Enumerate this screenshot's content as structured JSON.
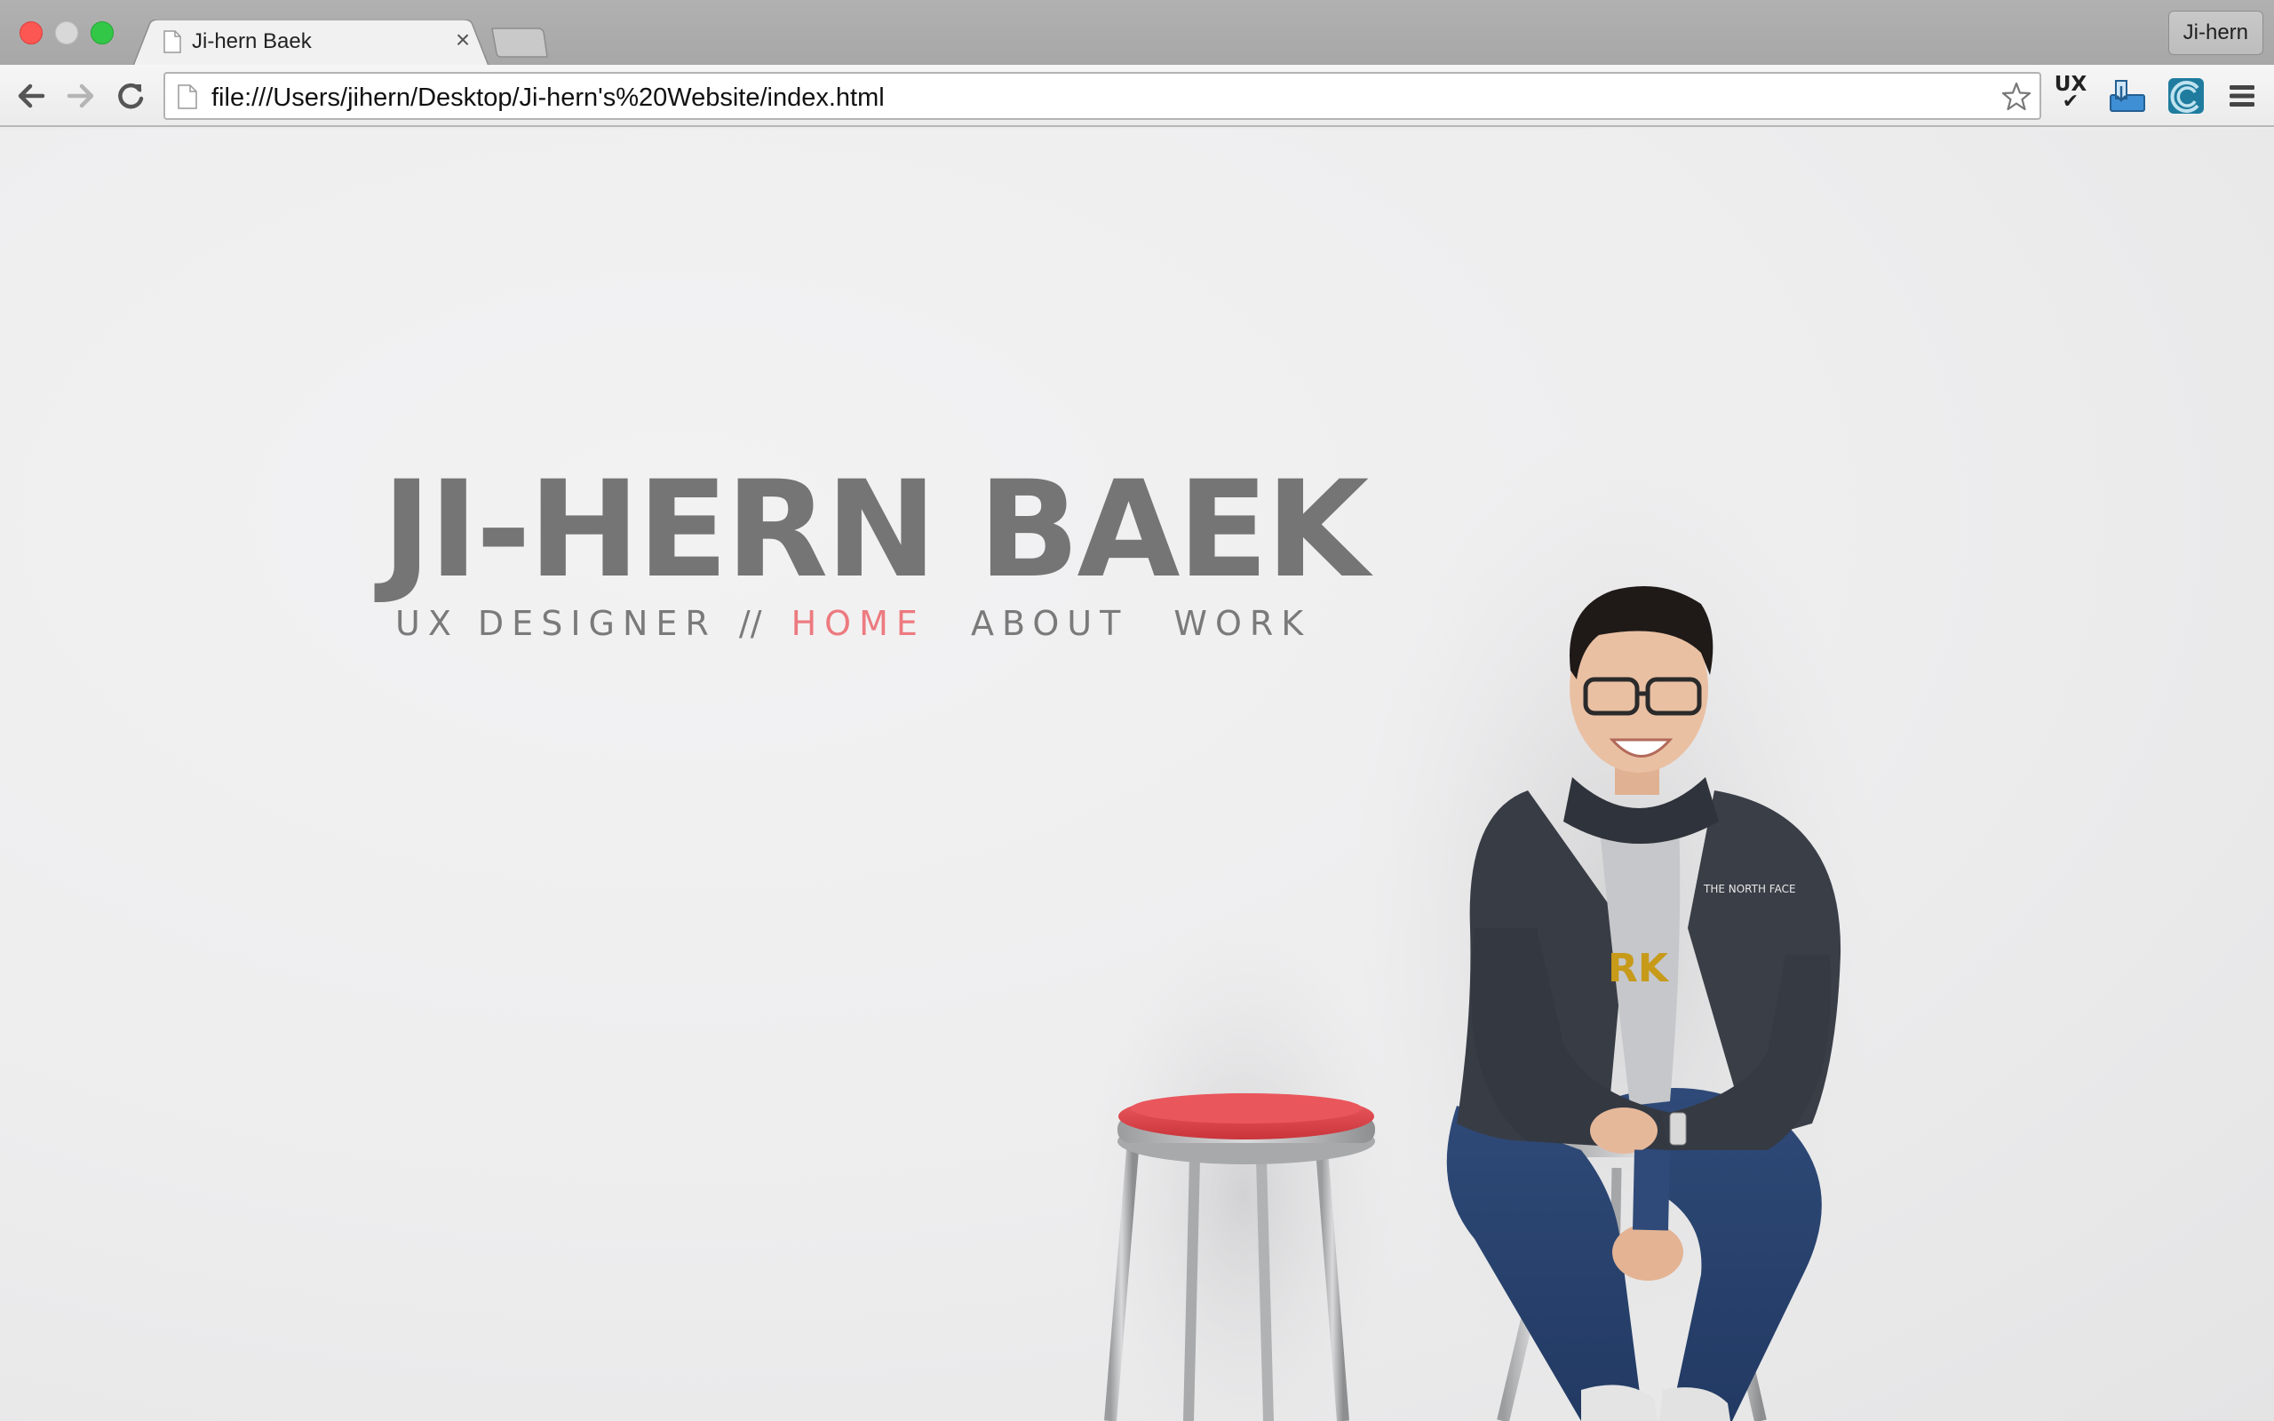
{
  "browser": {
    "tab": {
      "title": "Ji-hern Baek",
      "close_glyph": "×"
    },
    "profile": "Ji-hern",
    "url": "file:///Users/jihern/Desktop/Ji-hern's%20Website/index.html",
    "extensions": [
      {
        "icon": "ux-check-icon",
        "label": "UX",
        "mark": "✔"
      },
      {
        "icon": "inbox-download-icon"
      },
      {
        "icon": "swirl-extension-icon"
      }
    ],
    "menu_icon": "hamburger-menu-icon"
  },
  "page": {
    "title": "JI-HERN BAEK",
    "role": "UX DESIGNER",
    "separator": "//",
    "nav": [
      {
        "label": "HOME",
        "active": true
      },
      {
        "label": "ABOUT",
        "active": false
      },
      {
        "label": "WORK",
        "active": false
      }
    ],
    "colors": {
      "title": "#757575",
      "nav_active": "#ec7a7f",
      "nav": "#7a7a7a",
      "background": "#ededee"
    }
  }
}
